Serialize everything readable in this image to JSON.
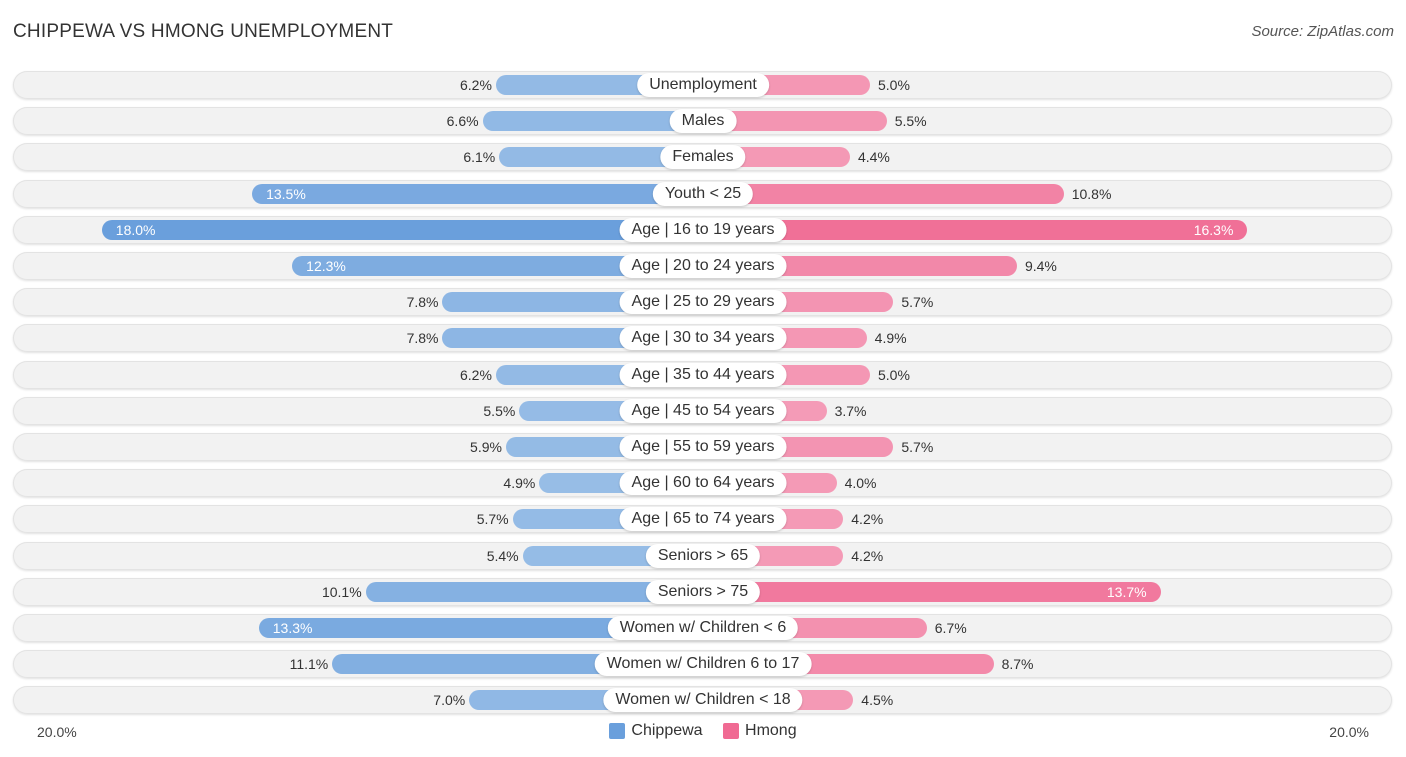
{
  "header": {
    "title": "CHIPPEWA VS HMONG UNEMPLOYMENT",
    "source": "Source: ZipAtlas.com"
  },
  "colors": {
    "chippewa_strong": "#6a9fdc",
    "chippewa_light": "#a8c8ea",
    "hmong_strong": "#f06a93",
    "hmong_light": "#f5a8c0"
  },
  "chart_data": {
    "type": "bar",
    "orientation": "horizontal-diverging",
    "title": "CHIPPEWA VS HMONG UNEMPLOYMENT",
    "xlabel": "",
    "ylabel": "",
    "xlim": [
      -20.0,
      20.0
    ],
    "axis_labels": {
      "left": "20.0%",
      "right": "20.0%"
    },
    "legend_position": "bottom-center",
    "categories": [
      "Unemployment",
      "Males",
      "Females",
      "Youth < 25",
      "Age | 16 to 19 years",
      "Age | 20 to 24 years",
      "Age | 25 to 29 years",
      "Age | 30 to 34 years",
      "Age | 35 to 44 years",
      "Age | 45 to 54 years",
      "Age | 55 to 59 years",
      "Age | 60 to 64 years",
      "Age | 65 to 74 years",
      "Seniors > 65",
      "Seniors > 75",
      "Women w/ Children < 6",
      "Women w/ Children 6 to 17",
      "Women w/ Children < 18"
    ],
    "series": [
      {
        "name": "Chippewa",
        "side": "left",
        "values": [
          6.2,
          6.6,
          6.1,
          13.5,
          18.0,
          12.3,
          7.8,
          7.8,
          6.2,
          5.5,
          5.9,
          4.9,
          5.7,
          5.4,
          10.1,
          13.3,
          11.1,
          7.0
        ],
        "labels": [
          "6.2%",
          "6.6%",
          "6.1%",
          "13.5%",
          "18.0%",
          "12.3%",
          "7.8%",
          "7.8%",
          "6.2%",
          "5.5%",
          "5.9%",
          "4.9%",
          "5.7%",
          "5.4%",
          "10.1%",
          "13.3%",
          "11.1%",
          "7.0%"
        ]
      },
      {
        "name": "Hmong",
        "side": "right",
        "values": [
          5.0,
          5.5,
          4.4,
          10.8,
          16.3,
          9.4,
          5.7,
          4.9,
          5.0,
          3.7,
          5.7,
          4.0,
          4.2,
          4.2,
          13.7,
          6.7,
          8.7,
          4.5
        ],
        "labels": [
          "5.0%",
          "5.5%",
          "4.4%",
          "10.8%",
          "16.3%",
          "9.4%",
          "5.7%",
          "4.9%",
          "5.0%",
          "3.7%",
          "5.7%",
          "4.0%",
          "4.2%",
          "4.2%",
          "13.7%",
          "6.7%",
          "8.7%",
          "4.5%"
        ]
      }
    ]
  },
  "legend": {
    "items": [
      {
        "label": "Chippewa",
        "color": "#6a9fdc"
      },
      {
        "label": "Hmong",
        "color": "#f06a93"
      }
    ]
  }
}
